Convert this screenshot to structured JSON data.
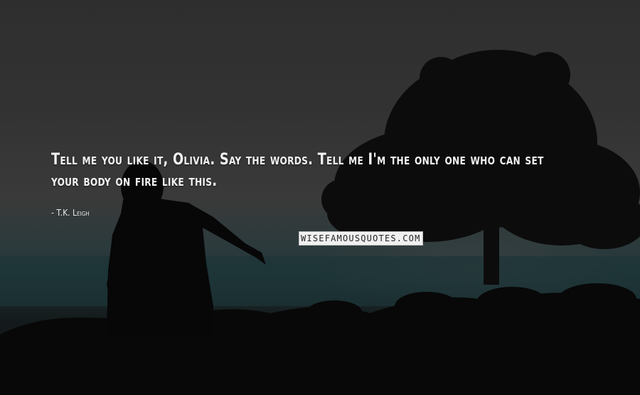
{
  "quote": {
    "text": "Tell me you like it, Olivia. Say the words. Tell me I'm the only one who can set your body on fire like this.",
    "author": "- T.K. Leigh"
  },
  "watermark": "WISEFAMOUSQUOTES.COM",
  "colors": {
    "text": "#f2f2f2",
    "sky": "#333333",
    "horizon_teal": "#213538",
    "silhouette": "#0a0a0a"
  }
}
